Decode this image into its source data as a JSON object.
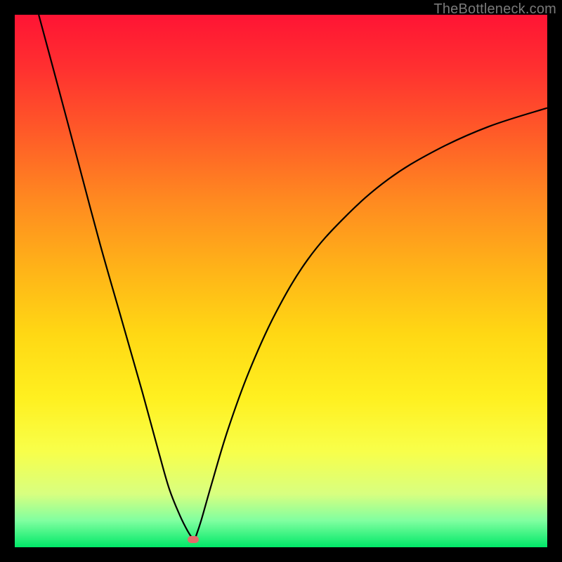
{
  "watermark": "TheBottleneck.com",
  "colors": {
    "curve_stroke": "#000000",
    "min_marker": "#e46a6a"
  },
  "chart_data": {
    "type": "line",
    "title": "",
    "xlabel": "",
    "ylabel": "",
    "xlim": [
      0,
      100
    ],
    "ylim": [
      0,
      100
    ],
    "grid": false,
    "legend": false,
    "min_marker": {
      "x": 33.5,
      "y": 1.5
    },
    "series": [
      {
        "name": "left-branch",
        "x": [
          4.5,
          8,
          12,
          16,
          20,
          24,
          27,
          29,
          31,
          32.5,
          33.5
        ],
        "y": [
          100,
          87,
          72,
          57,
          43,
          29,
          18,
          11,
          6,
          3,
          1.5
        ]
      },
      {
        "name": "right-branch",
        "x": [
          34,
          35,
          37,
          40,
          44,
          49,
          55,
          62,
          70,
          79,
          89,
          100
        ],
        "y": [
          2,
          5,
          12,
          22,
          33,
          44,
          54,
          62,
          69,
          74.5,
          79,
          82.5
        ]
      }
    ]
  }
}
